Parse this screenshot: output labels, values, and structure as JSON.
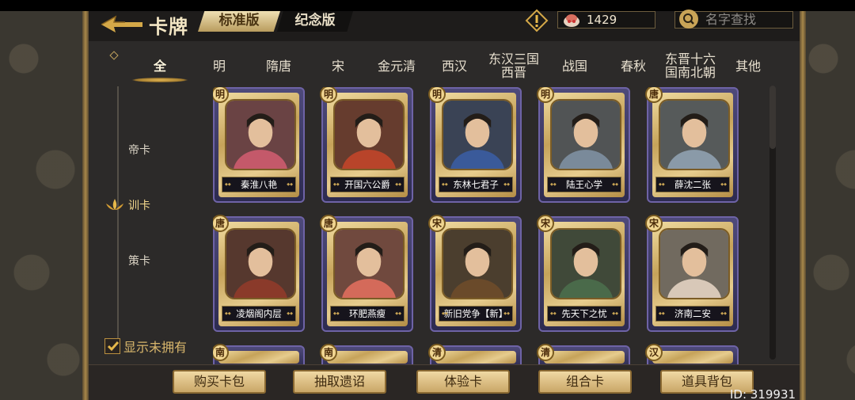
{
  "header": {
    "title": "卡牌",
    "version_tabs": [
      {
        "label": "标准版",
        "active": true
      },
      {
        "label": "纪念版",
        "active": false
      }
    ],
    "coins": "1429",
    "search_placeholder": "名字查找"
  },
  "dynasty_tabs": [
    {
      "label": "全",
      "active": true
    },
    {
      "label": "明"
    },
    {
      "label": "隋唐"
    },
    {
      "label": "宋"
    },
    {
      "label": "金元清"
    },
    {
      "label": "西汉"
    },
    {
      "label": "东汉三国西晋"
    },
    {
      "label": "战国"
    },
    {
      "label": "春秋"
    },
    {
      "label": "东晋十六国南北朝"
    },
    {
      "label": "其他"
    }
  ],
  "left_nav": {
    "items": [
      {
        "label": "帝卡",
        "active": false
      },
      {
        "label": "训卡",
        "active": true
      },
      {
        "label": "策卡",
        "active": false
      }
    ],
    "show_owned_label": "显示未拥有",
    "show_owned_checked": true
  },
  "cards": [
    {
      "dynasty": "明",
      "name": "秦淮八艳",
      "color": "#c4596a"
    },
    {
      "dynasty": "明",
      "name": "开国六公爵",
      "color": "#b8442a"
    },
    {
      "dynasty": "明",
      "name": "东林七君子",
      "color": "#3a5a9a"
    },
    {
      "dynasty": "明",
      "name": "陆王心学",
      "color": "#7a8a9a"
    },
    {
      "dynasty": "唐",
      "name": "薛沈二张",
      "color": "#8a9aa8"
    },
    {
      "dynasty": "唐",
      "name": "凌烟阁内层",
      "color": "#8a3a2a"
    },
    {
      "dynasty": "唐",
      "name": "环肥燕瘦",
      "color": "#d46a5a"
    },
    {
      "dynasty": "宋",
      "name": "新旧党争【新】",
      "color": "#6a4a2a"
    },
    {
      "dynasty": "宋",
      "name": "先天下之忧",
      "color": "#4a6a4a"
    },
    {
      "dynasty": "宋",
      "name": "济南二安",
      "color": "#d8c8b8"
    }
  ],
  "peek_cards": [
    {
      "dynasty": "南"
    },
    {
      "dynasty": "南"
    },
    {
      "dynasty": "清"
    },
    {
      "dynasty": "清"
    },
    {
      "dynasty": "汉"
    }
  ],
  "bottom_buttons": [
    {
      "label": "购买卡包"
    },
    {
      "label": "抽取遗诏"
    },
    {
      "label": "体验卡"
    },
    {
      "label": "组合卡"
    },
    {
      "label": "道具背包"
    }
  ],
  "user_id": "ID: 319931"
}
